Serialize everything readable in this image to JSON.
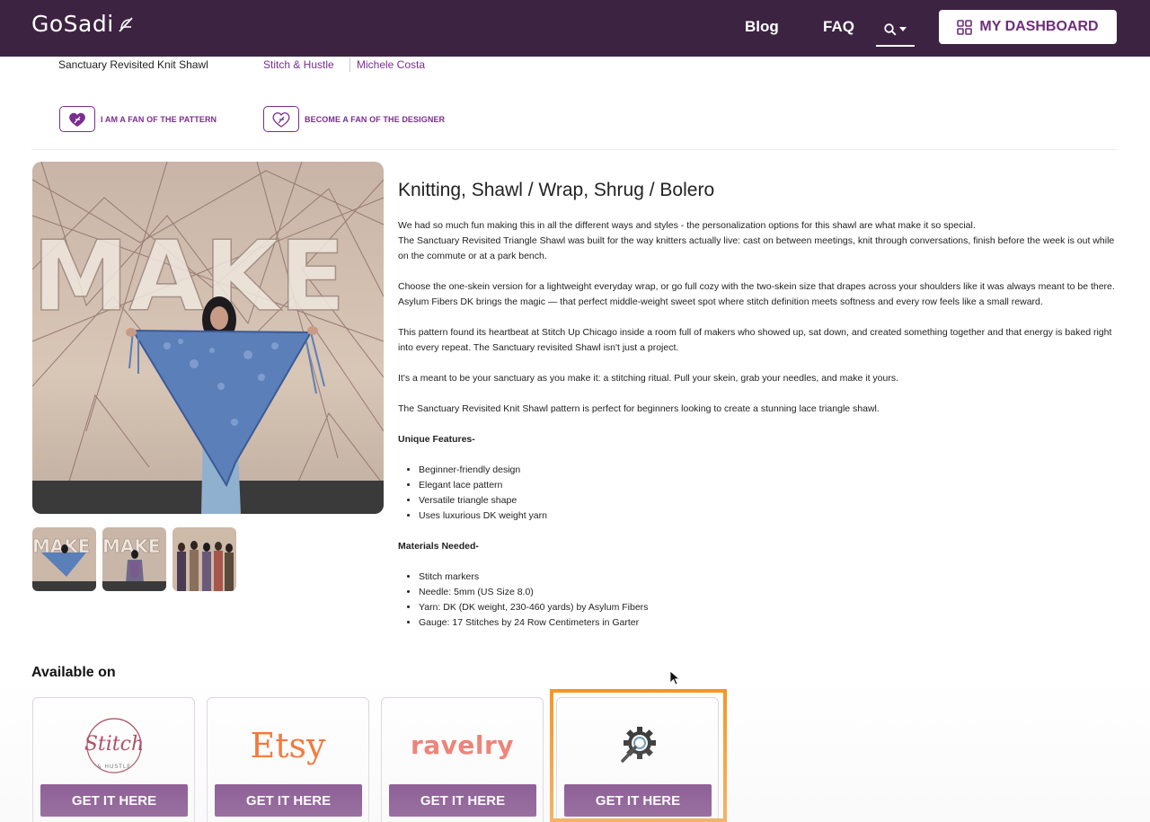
{
  "header": {
    "logo_text": "GoSadi",
    "nav": [
      {
        "label": "Blog"
      },
      {
        "label": "FAQ"
      }
    ],
    "dashboard_label": "MY DASHBOARD",
    "bg_color": "#3d2342"
  },
  "subheader": {
    "pattern_name": "Sanctuary Revisited Knit Shawl",
    "brand_link": "Stitch & Hustle",
    "designer_link": "Michele Costa",
    "fan_pattern_label": "I AM A FAN OF THE PATTERN",
    "fan_designer_label": "BECOME A FAN OF THE DESIGNER"
  },
  "product": {
    "category": "Knitting, Shawl / Wrap, Shrug / Bolero",
    "paragraphs": [
      "We had so much fun making this in all the different ways and styles - the personalization options for this shawl are what make it so special.",
      "The Sanctuary Revisited Triangle Shawl was built for the way knitters actually live: cast on between meetings, knit through conversations, finish before the week is out while on the commute or at a park bench.",
      "Choose the one-skein version for a lightweight everyday wrap, or go full cozy with the two-skein size that drapes across your shoulders like it was always meant to be there. Asylum Fibers DK brings the magic — that perfect middle-weight sweet spot where stitch definition meets softness and every row feels like a small reward.",
      "This pattern found its heartbeat at Stitch Up Chicago inside a room full of makers who showed up, sat down, and created something together and that energy is baked right into every repeat. The Sanctuary revisited Shawl isn't just a project.",
      "It's a meant to be your sanctuary as you make it: a stitching ritual. Pull your skein, grab your needles, and make it yours.",
      "The Sanctuary Revisited Knit Shawl pattern is perfect for beginners looking to create a stunning lace triangle shawl."
    ],
    "features_heading": "Unique Features-",
    "features": [
      "Beginner-friendly design",
      "Elegant lace pattern",
      "Versatile triangle shape",
      "Uses luxurious DK weight yarn"
    ],
    "materials_heading": "Materials Needed-",
    "materials": [
      "Stitch markers",
      "Needle: 5mm (US Size 8.0)",
      "Yarn: DK (DK weight, 230-460 yards) by Asylum Fibers",
      "Gauge: 17 Stitches by 24 Row Centimeters in Garter"
    ],
    "image_wall_text": "MAKE"
  },
  "available": {
    "title": "Available on",
    "stores": [
      {
        "logo_text": "Stitch",
        "logo_sub": "& HUSTLE",
        "button": "GET IT HERE",
        "logo_color": "#a3324a"
      },
      {
        "logo_text": "Etsy",
        "button": "GET IT HERE",
        "logo_color": "#f1641e"
      },
      {
        "logo_text": "ravelry",
        "button": "GET IT HERE",
        "logo_color": "#ee6e62"
      },
      {
        "logo_text": "",
        "icon": "gear-search-icon",
        "button": "GET IT HERE",
        "highlighted": true
      }
    ],
    "button_color": "#6d2f78",
    "highlight_color": "#f7931e"
  }
}
